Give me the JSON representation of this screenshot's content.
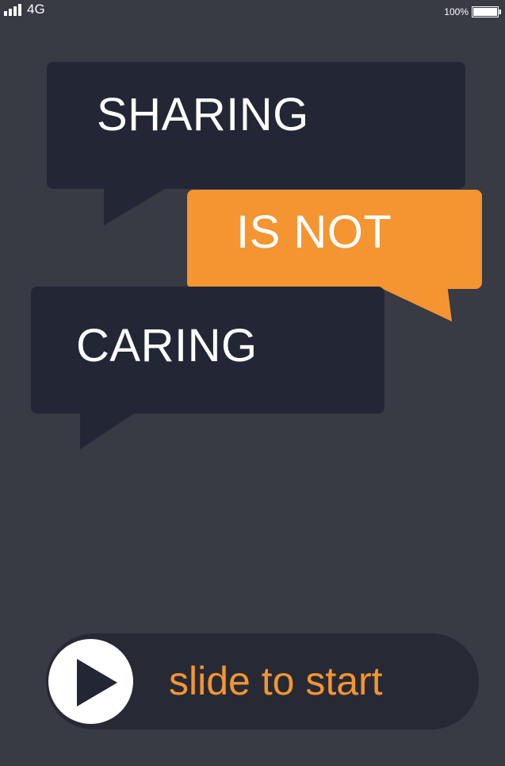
{
  "status_bar": {
    "network": "4G",
    "battery_percent": "100%"
  },
  "bubbles": [
    {
      "text": "SHARING"
    },
    {
      "text": "IS NOT"
    },
    {
      "text": "CARING"
    }
  ],
  "slider": {
    "label": "slide to start"
  },
  "colors": {
    "background": "#383a44",
    "bubble_dark": "#232735",
    "bubble_accent": "#f49532",
    "text": "#ffffff"
  }
}
